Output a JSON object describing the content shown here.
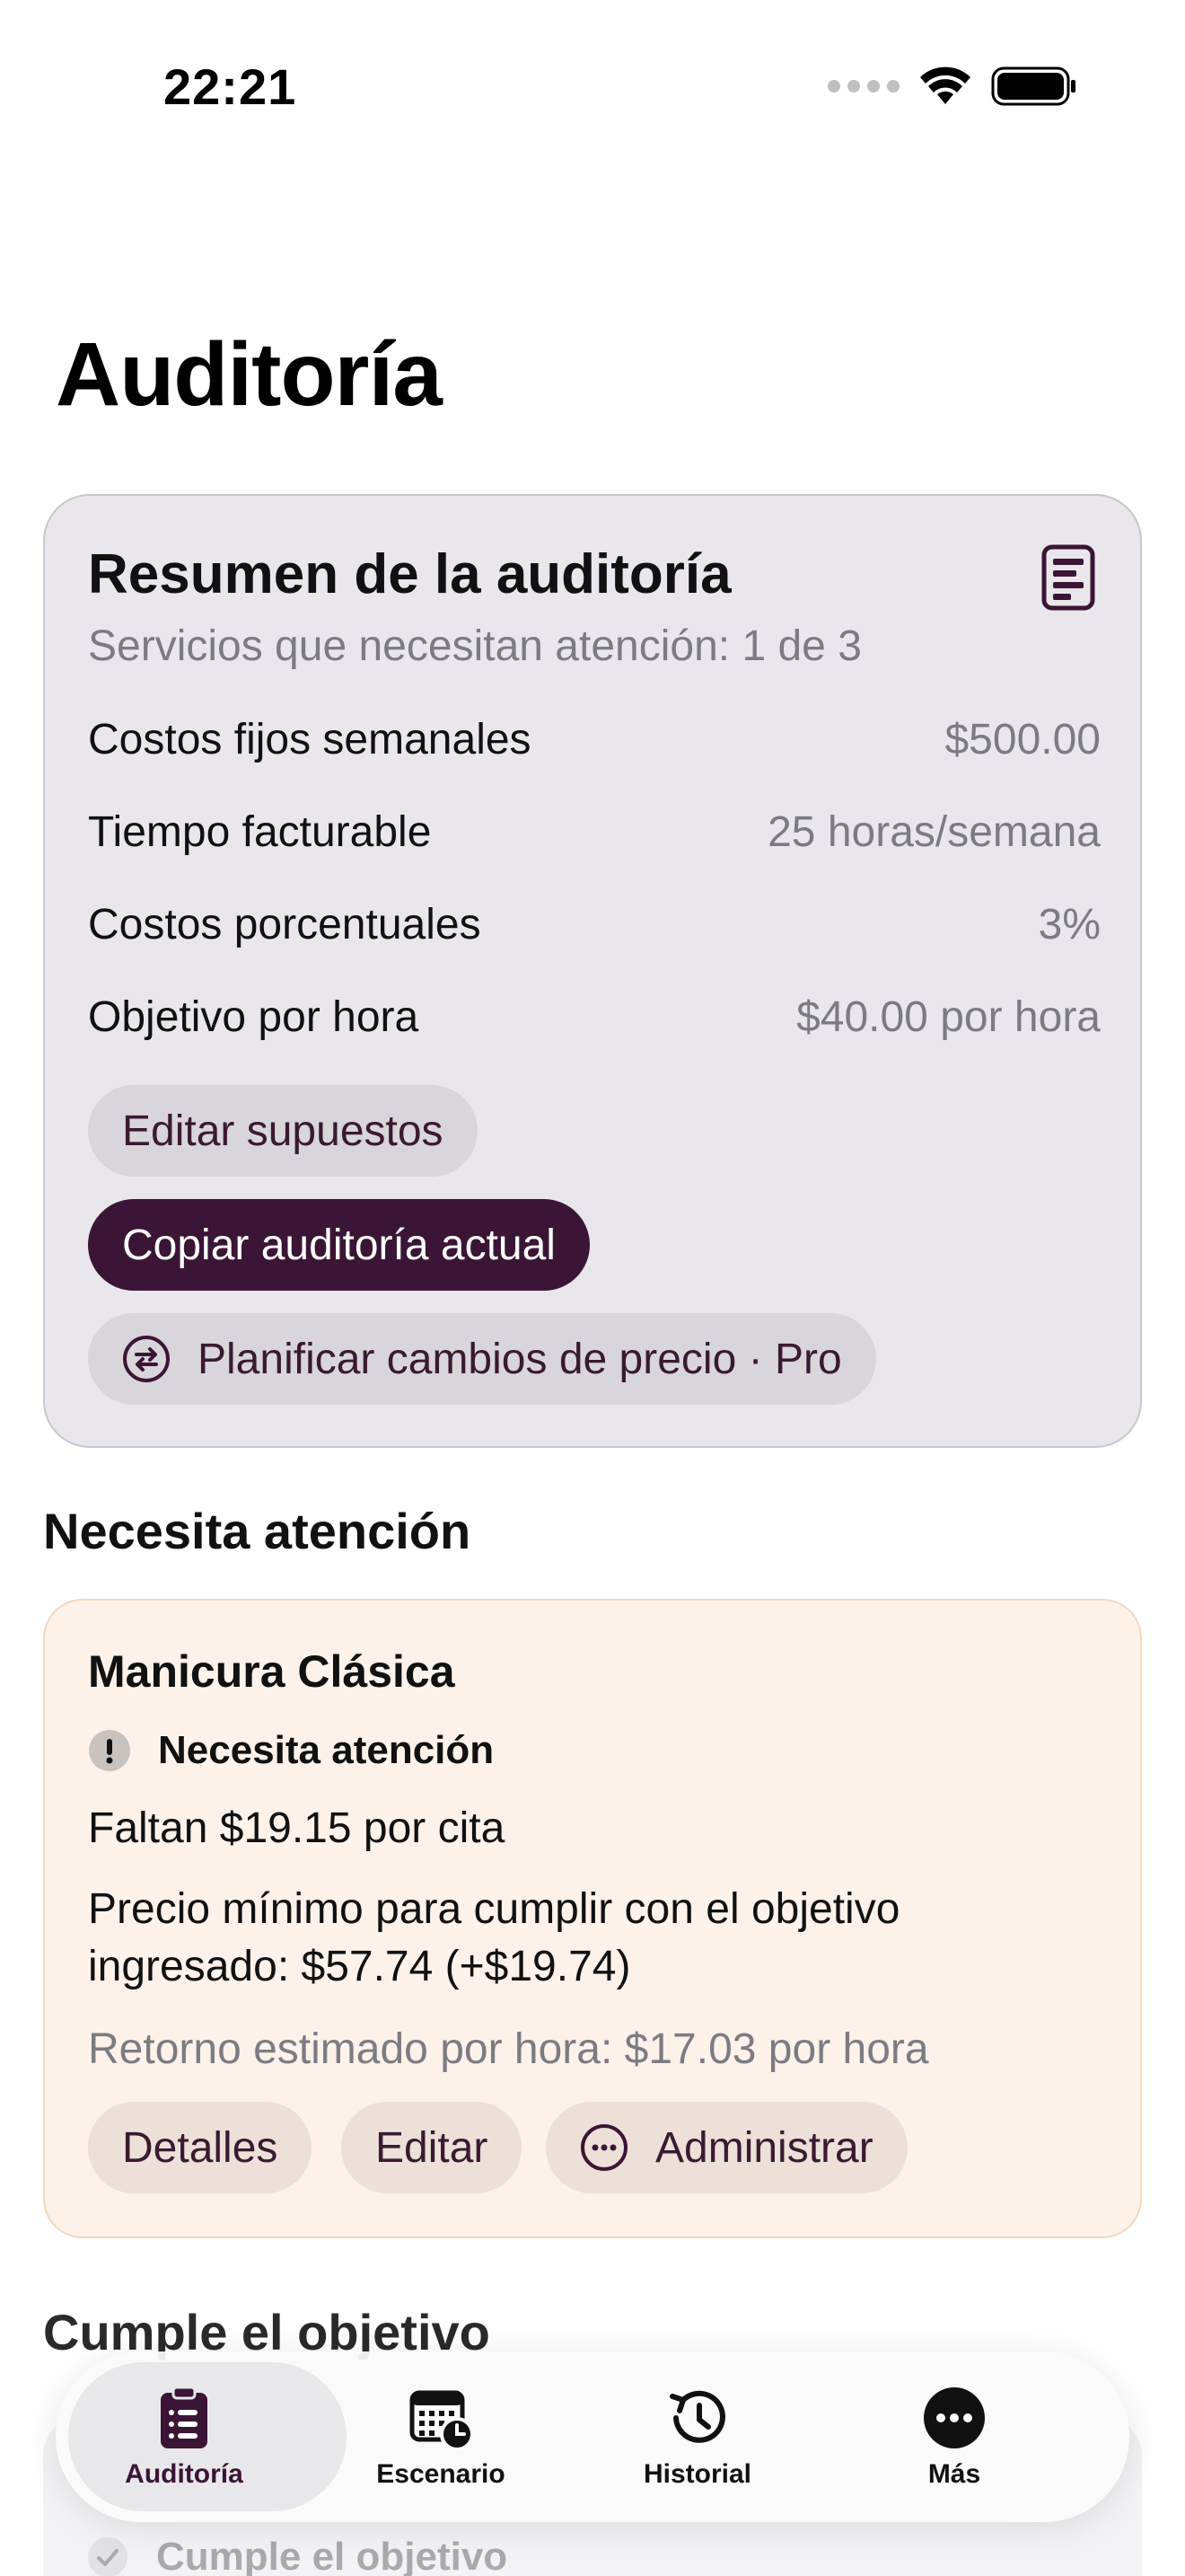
{
  "status_bar": {
    "time": "22:21"
  },
  "page": {
    "title": "Auditoría"
  },
  "summary": {
    "title": "Resumen de la auditoría",
    "subtitle": "Servicios que necesitan atención: 1 de 3",
    "rows": [
      {
        "label": "Costos fijos semanales",
        "value": "$500.00"
      },
      {
        "label": "Tiempo facturable",
        "value": "25 horas/semana"
      },
      {
        "label": "Costos porcentuales",
        "value": "3%"
      },
      {
        "label": "Objetivo por hora",
        "value": "$40.00 por hora"
      }
    ],
    "edit_button": "Editar supuestos",
    "copy_button": "Copiar auditoría actual",
    "plan_button": "Planificar cambios de precio · Pro"
  },
  "attention_section": {
    "title": "Necesita atención",
    "card": {
      "service": "Manicura Clásica",
      "status": "Necesita atención",
      "shortfall": "Faltan $19.15 por cita",
      "min_price": "Precio mínimo para cumplir con el objetivo ingresado: $57.74 (+$19.74)",
      "estimated_return": "Retorno estimado por hora: $17.03 por hora",
      "details_button": "Detalles",
      "edit_button": "Editar",
      "manage_button": "Administrar"
    }
  },
  "meets_section": {
    "title": "Cumple el objetivo",
    "card": {
      "status": "Cumple el objetivo"
    }
  },
  "tab_bar": {
    "tabs": [
      {
        "label": "Auditoría",
        "icon": "clipboard-list-icon",
        "active": true
      },
      {
        "label": "Escenario",
        "icon": "calendar-clock-icon",
        "active": false
      },
      {
        "label": "Historial",
        "icon": "history-icon",
        "active": false
      },
      {
        "label": "Más",
        "icon": "more-icon",
        "active": false
      }
    ]
  },
  "colors": {
    "accent": "#3b1535",
    "summary_card_bg": "#e9e7ec",
    "attention_card_bg": "#fcf2ea",
    "muted_text": "#7d7b82"
  }
}
